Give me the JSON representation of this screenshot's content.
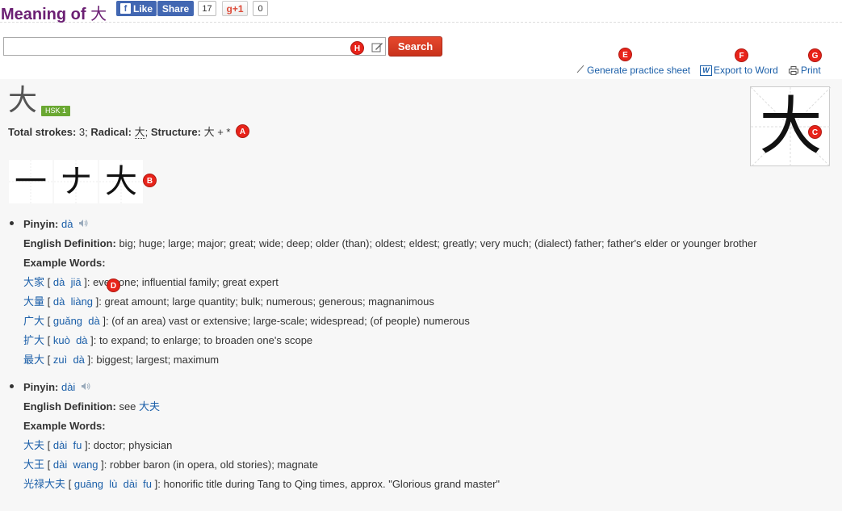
{
  "header": {
    "title_prefix": "Meaning of",
    "title_char": "大",
    "like_label": "Like",
    "like_count": "17",
    "share_label": "Share",
    "gplus_label": "g+1",
    "gplus_count": "0"
  },
  "search": {
    "value": "",
    "button_label": "Search"
  },
  "tools": {
    "practice_label": "Generate practice sheet",
    "word_label": "Export to Word",
    "print_label": "Print"
  },
  "char": {
    "glyph": "大",
    "hsk": "HSK 1",
    "strokes_label": "Total strokes:",
    "strokes_value": "3;",
    "radical_label": "Radical:",
    "radical_value": "大",
    "structure_label": "Structure:",
    "structure_value": "大 + *"
  },
  "strokes": [
    "一",
    "ナ",
    "大"
  ],
  "markers": {
    "a": "A",
    "b": "B",
    "c": "C",
    "d": "D",
    "e": "E",
    "f": "F",
    "g": "G",
    "h": "H"
  },
  "readings": [
    {
      "pinyin_label": "Pinyin:",
      "pinyin": "dà",
      "def_label": "English Definition:",
      "definition": "big; huge; large; major; great; wide; deep; older (than); oldest; eldest; greatly; very much; (dialect) father; father's elder or younger brother",
      "examples_label": "Example Words:",
      "examples": [
        {
          "word": "大家",
          "open": "[",
          "py": "dà  jiā",
          "close": "]:",
          "meaning": "everyone; influential family; great expert"
        },
        {
          "word": "大量",
          "open": "[",
          "py": "dà  liàng",
          "close": "]:",
          "meaning": "great amount; large quantity; bulk; numerous; generous; magnanimous"
        },
        {
          "word": "广大",
          "open": "[",
          "py": "guǎng  dà",
          "close": "]:",
          "meaning": "(of an area) vast or extensive; large-scale; widespread; (of people) numerous"
        },
        {
          "word": "扩大",
          "open": "[",
          "py": "kuò  dà",
          "close": "]:",
          "meaning": "to expand; to enlarge; to broaden one's scope"
        },
        {
          "word": "最大",
          "open": "[",
          "py": "zuì  dà",
          "close": "]:",
          "meaning": "biggest; largest; maximum"
        }
      ]
    },
    {
      "pinyin_label": "Pinyin:",
      "pinyin": "dài",
      "def_label": "English Definition:",
      "definition_prefix": "see",
      "definition_link": "大夫",
      "examples_label": "Example Words:",
      "examples": [
        {
          "word": "大夫",
          "open": "[",
          "py": "dài  fu",
          "close": "]:",
          "meaning": "doctor; physician"
        },
        {
          "word": "大王",
          "open": "[",
          "py": "dài  wang",
          "close": "]:",
          "meaning": "robber baron (in opera, old stories); magnate"
        },
        {
          "word": "光禄大夫",
          "open": "[",
          "py": "guāng  lù  dài  fu",
          "close": "]:",
          "meaning": "honorific title during Tang to Qing times, approx. \"Glorious grand master\""
        }
      ]
    }
  ]
}
